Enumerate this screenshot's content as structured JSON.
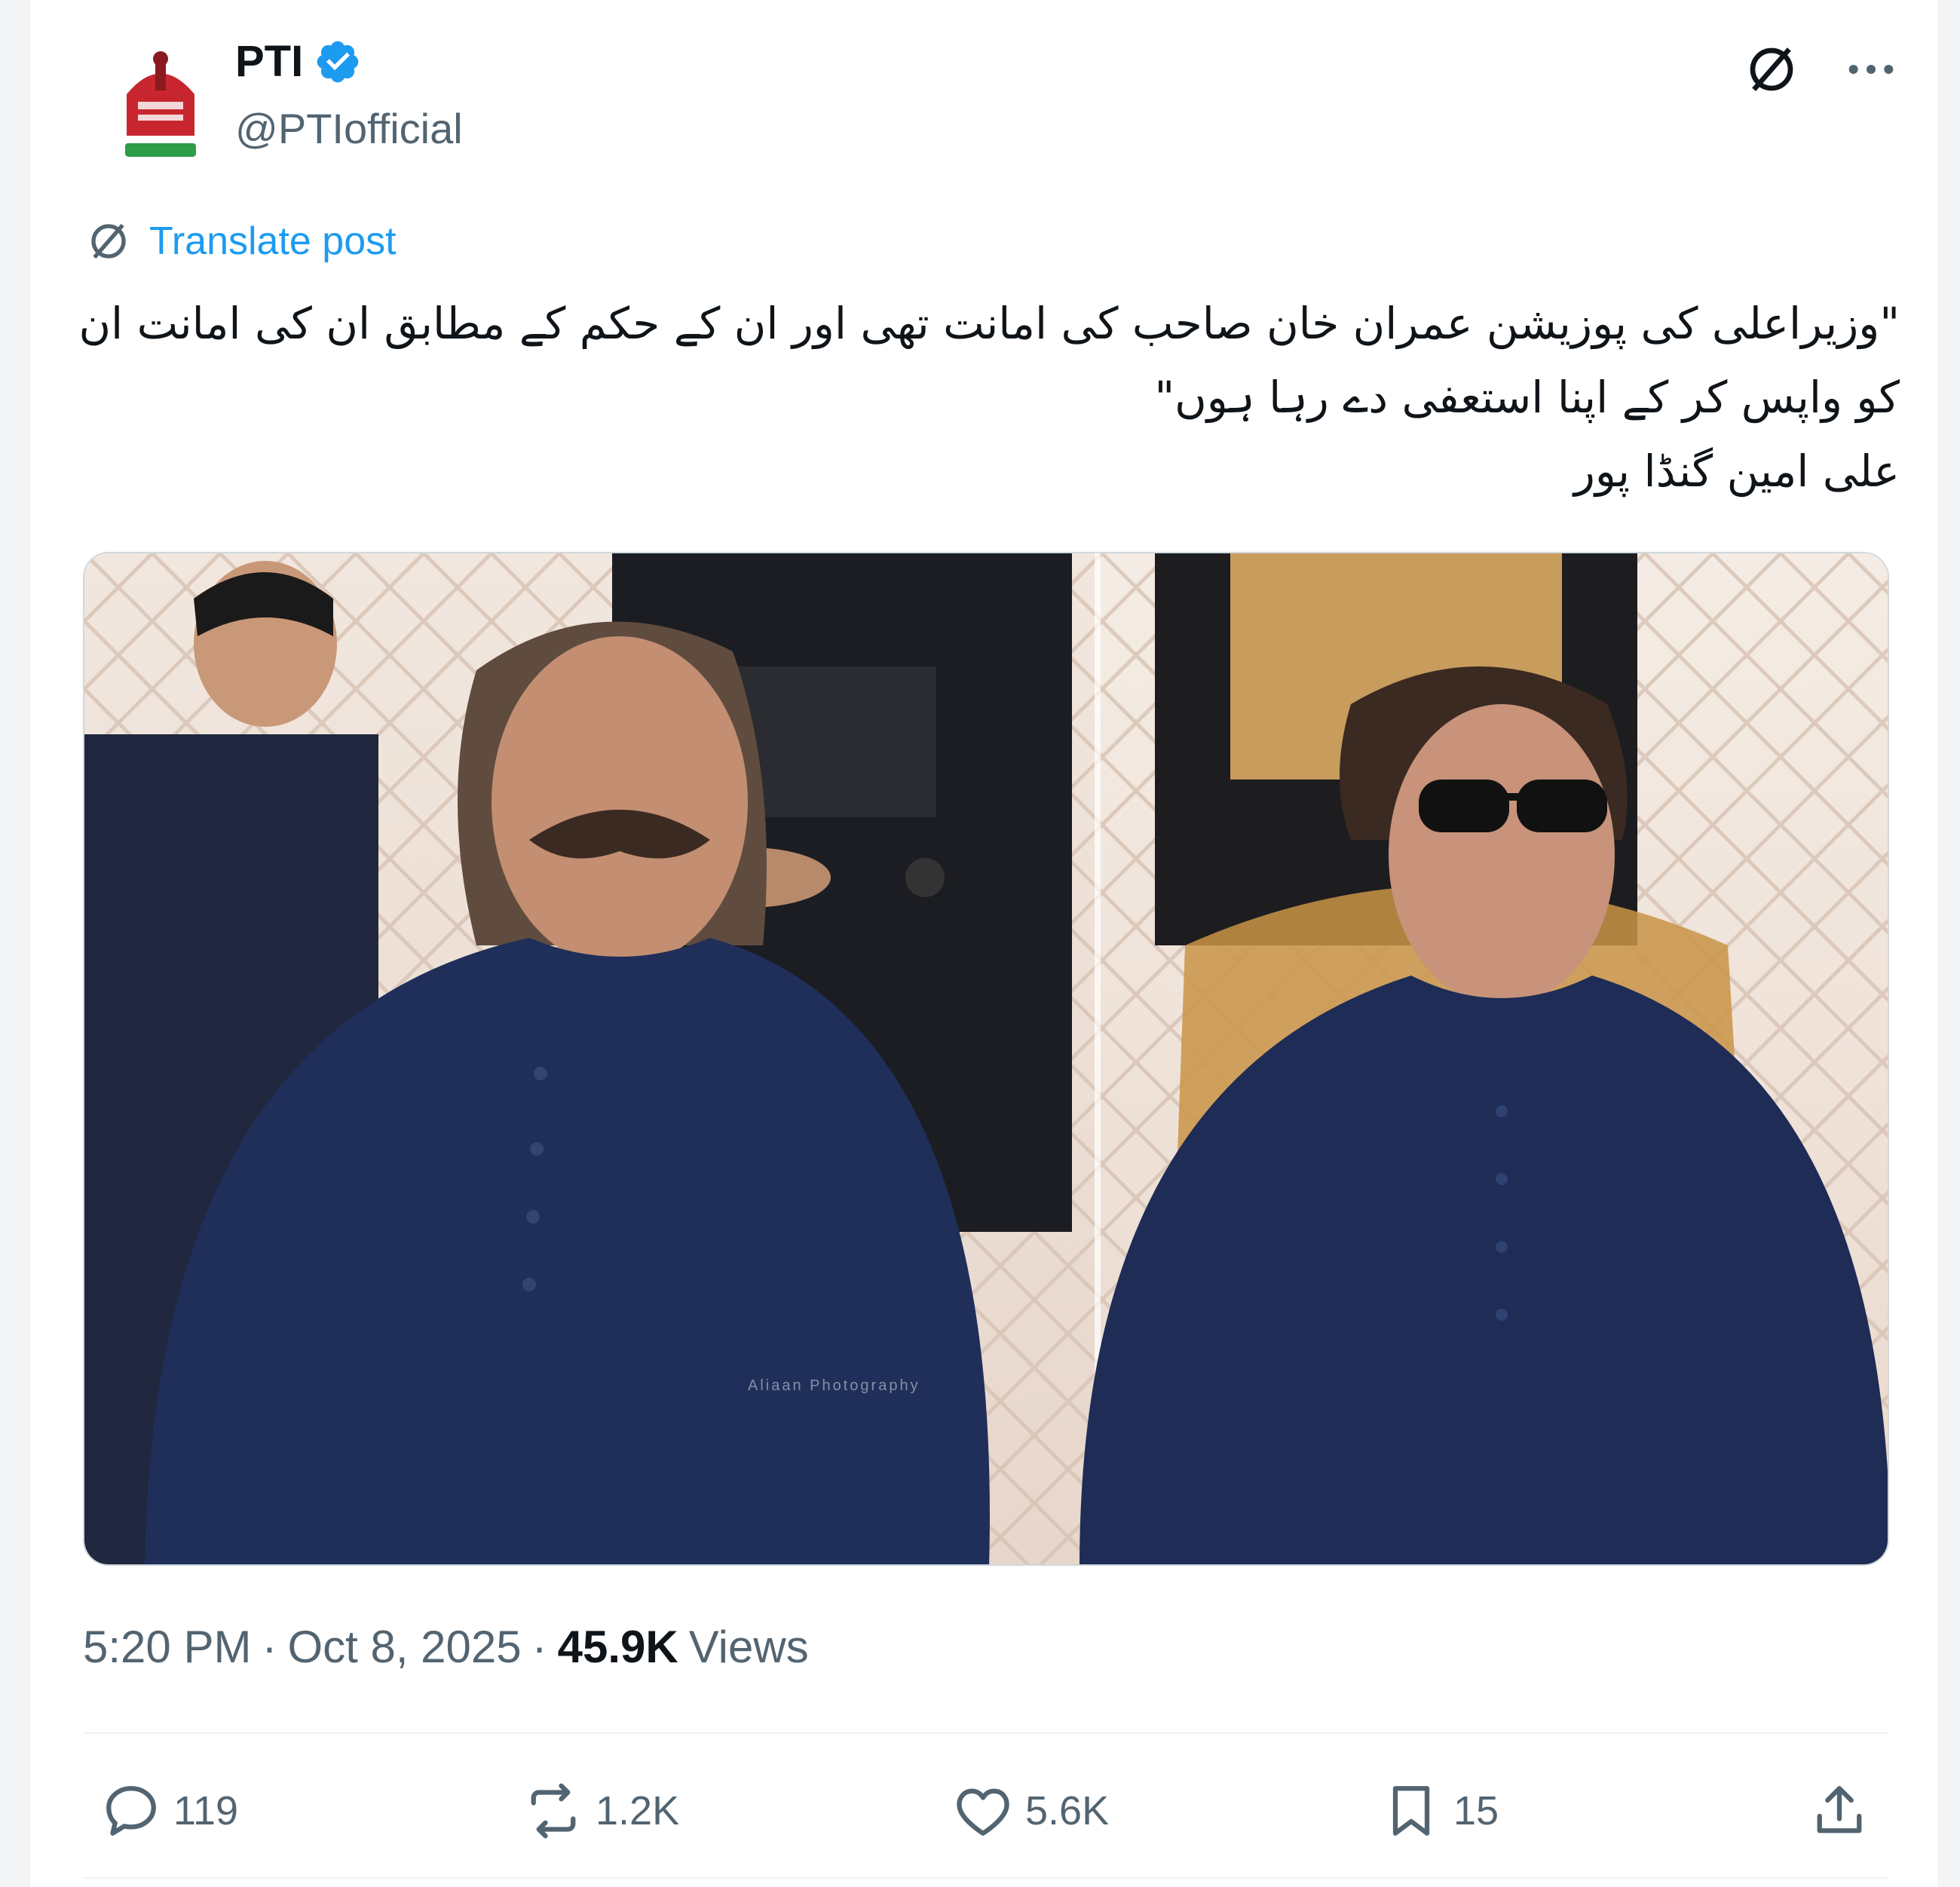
{
  "post": {
    "display_name": "PTI",
    "handle": "@PTIofficial",
    "translate_label": "Translate post",
    "text_lines": [
      "\"وزیراعلی کی پوزیشن عمران خان صاحب کی امانت تھی اور ان کے حکم کے مطابق ان کی امانت ان",
      "کو واپس کر کے اپنا استعفی دے رہا ہوں\"",
      "علی امین گنڈا پور"
    ],
    "image_watermark": "Aliaan Photography",
    "time": "5:20 PM",
    "date": "Oct 8, 2025",
    "views_count": "45.9K",
    "views_label": "Views",
    "separator": "·"
  },
  "actions": {
    "replies": "119",
    "reposts": "1.2K",
    "likes": "5.6K",
    "bookmarks": "15"
  },
  "icons": {
    "top_right": [
      "grok-icon",
      "more-icon"
    ],
    "action_bar": [
      "reply-icon",
      "repost-icon",
      "like-icon",
      "bookmark-icon",
      "share-icon"
    ]
  },
  "colors": {
    "accent": "#1d9bf0",
    "text": "#0f1419",
    "secondary": "#536471",
    "logo_red": "#c8262f",
    "logo_green": "#2e9b48"
  }
}
